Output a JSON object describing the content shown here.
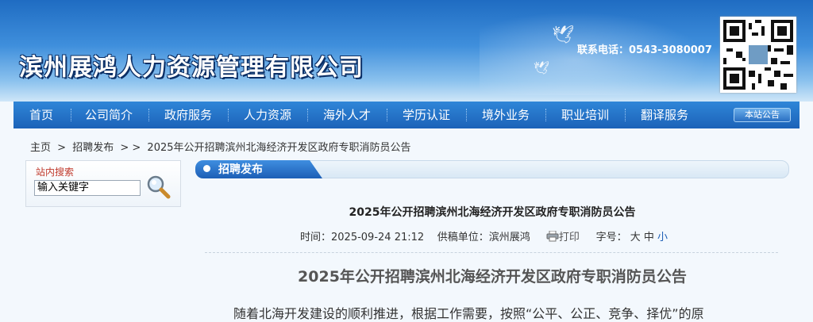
{
  "header": {
    "site_title": "滨州展鸿人力资源管理有限公司",
    "phone": "联系电话：0543-3080007"
  },
  "nav": {
    "items": [
      "首页",
      "公司简介",
      "政府服务",
      "人力资源",
      "海外人才",
      "学历认证",
      "境外业务",
      "职业培训",
      "翻译服务"
    ],
    "notice_button": "本站公告"
  },
  "breadcrumb": {
    "home": "主页",
    "sep1": ">",
    "section": "招聘发布",
    "sep2": "> >",
    "current": "2025年公开招聘滨州北海经济开发区政府专职消防员公告"
  },
  "search": {
    "label": "站内搜索",
    "value": "输入关键字"
  },
  "section_tab": {
    "label": "招聘发布"
  },
  "article": {
    "title": "2025年公开招聘滨州北海经济开发区政府专职消防员公告",
    "time_label": "时间：",
    "time_value": "2025-09-24 21:12",
    "source_label": "供稿单位：",
    "source_value": "滨州展鸿",
    "print_label": "打印",
    "fontsize_label": "字号：",
    "size_large": "大",
    "size_medium": "中",
    "size_small": "小",
    "heading": "2025年公开招聘滨州北海经济开发区政府专职消防员公告",
    "first_line": "随着北海开发建设的顺利推进，根据工作需要，按照“公平、公正、竞争、择优”的原"
  },
  "colors": {
    "header_blue": "#1f6cc2",
    "nav_blue": "#1c62b8",
    "accent_red": "#c0392b"
  }
}
